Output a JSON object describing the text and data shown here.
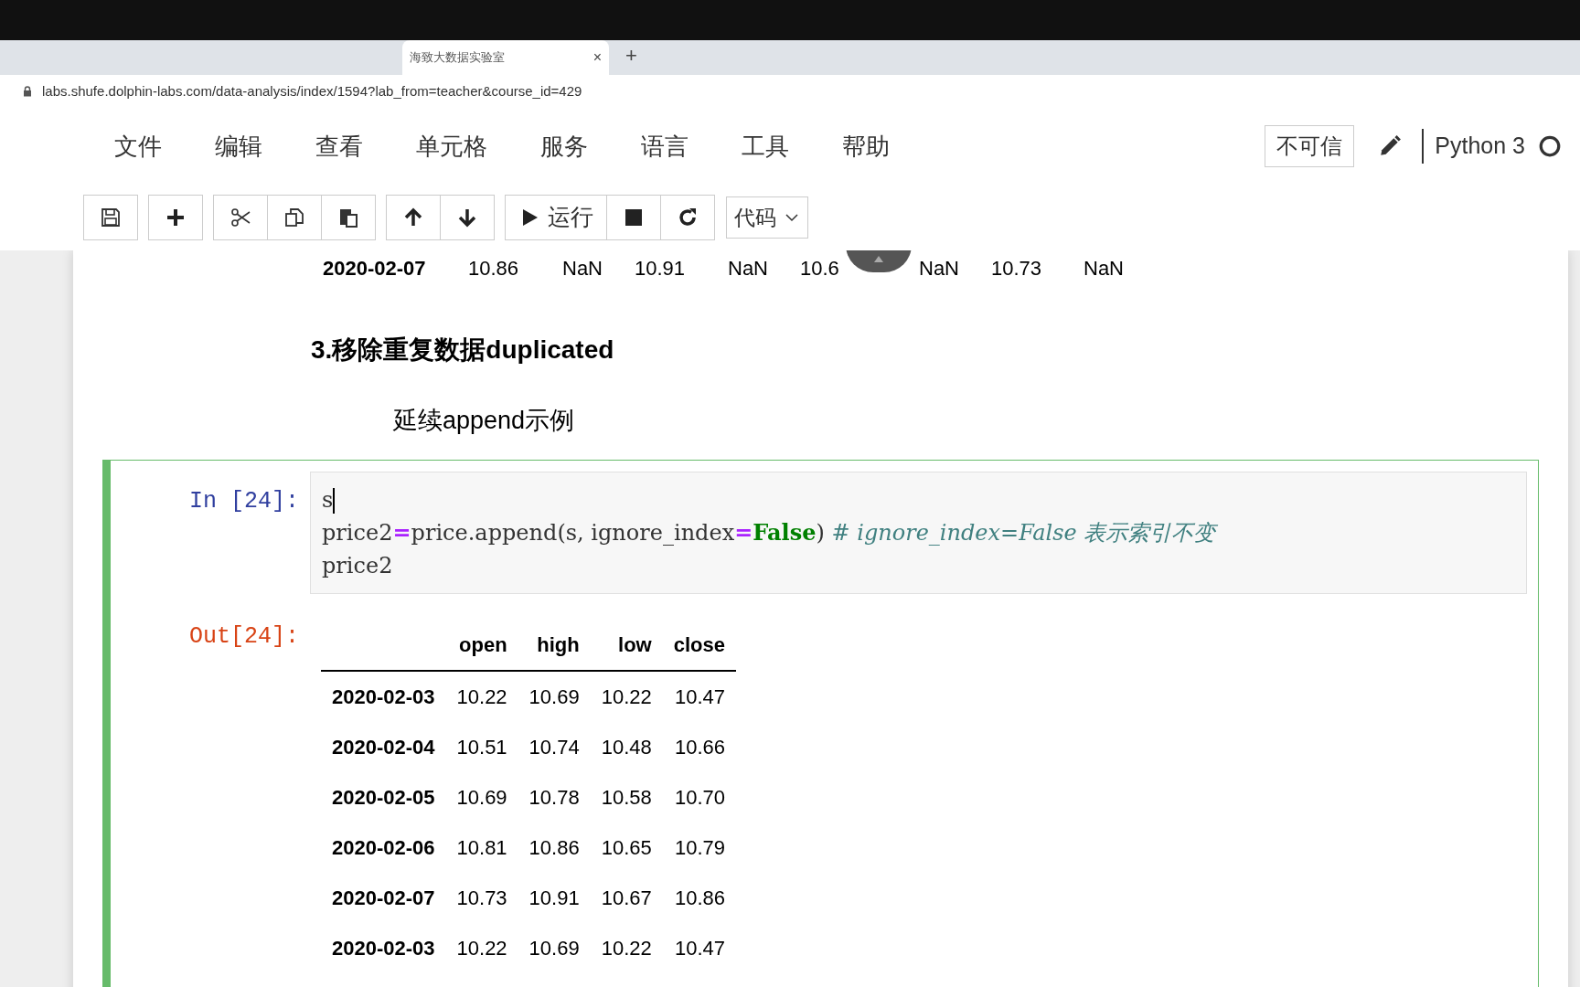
{
  "browser": {
    "tabs": [
      {
        "title": "海致大数据实验室",
        "close": "×",
        "selected": true
      }
    ],
    "new_tab": "+",
    "url": "labs.shufe.dolphin-labs.com/data-analysis/index/1594?lab_from=teacher&course_id=429"
  },
  "menu": {
    "items": [
      "文件",
      "编辑",
      "查看",
      "单元格",
      "服务",
      "语言",
      "工具",
      "帮助"
    ],
    "trust": "不可信",
    "kernel": "Python 3"
  },
  "toolbar": {
    "groups": [
      [
        {
          "kind": "save"
        }
      ],
      [
        {
          "kind": "add"
        }
      ],
      [
        {
          "kind": "cut"
        },
        {
          "kind": "copy"
        },
        {
          "kind": "paste"
        }
      ],
      [
        {
          "kind": "up"
        },
        {
          "kind": "down"
        }
      ],
      [
        {
          "kind": "run",
          "label": "运行"
        },
        {
          "kind": "stop"
        },
        {
          "kind": "restart"
        }
      ]
    ],
    "cell_type": "代码"
  },
  "previous_output_row": [
    "2020-02-07",
    "10.86",
    "NaN",
    "10.91",
    "NaN",
    "10.6",
    "NaN",
    "10.73",
    "NaN"
  ],
  "markdown": {
    "heading": "3.移除重复数据duplicated",
    "text": "延续append示例"
  },
  "cell": {
    "selected": true,
    "in_prompt": "In [24]:",
    "code": [
      [
        {
          "kind": "plain",
          "text": "s"
        }
      ],
      [
        {
          "kind": "plain",
          "text": "price2"
        },
        {
          "kind": "op",
          "text": "="
        },
        {
          "kind": "plain",
          "text": "price.append(s, ignore_index"
        },
        {
          "kind": "op",
          "text": "="
        },
        {
          "kind": "keyword",
          "text": "False"
        },
        {
          "kind": "plain",
          "text": ") "
        },
        {
          "kind": "comment",
          "text": "# ignore_index=False 表示索引不变"
        }
      ],
      [
        {
          "kind": "plain",
          "text": "price2"
        }
      ]
    ],
    "out_prompt": "Out[24]:",
    "table": {
      "columns": [
        "open",
        "high",
        "low",
        "close"
      ],
      "rows": [
        {
          "index": "2020-02-03",
          "values": [
            "10.22",
            "10.69",
            "10.22",
            "10.47"
          ]
        },
        {
          "index": "2020-02-04",
          "values": [
            "10.51",
            "10.74",
            "10.48",
            "10.66"
          ]
        },
        {
          "index": "2020-02-05",
          "values": [
            "10.69",
            "10.78",
            "10.58",
            "10.70"
          ]
        },
        {
          "index": "2020-02-06",
          "values": [
            "10.81",
            "10.86",
            "10.65",
            "10.79"
          ]
        },
        {
          "index": "2020-02-07",
          "values": [
            "10.73",
            "10.91",
            "10.67",
            "10.86"
          ]
        },
        {
          "index": "2020-02-03",
          "values": [
            "10.22",
            "10.69",
            "10.22",
            "10.47"
          ]
        }
      ]
    }
  }
}
